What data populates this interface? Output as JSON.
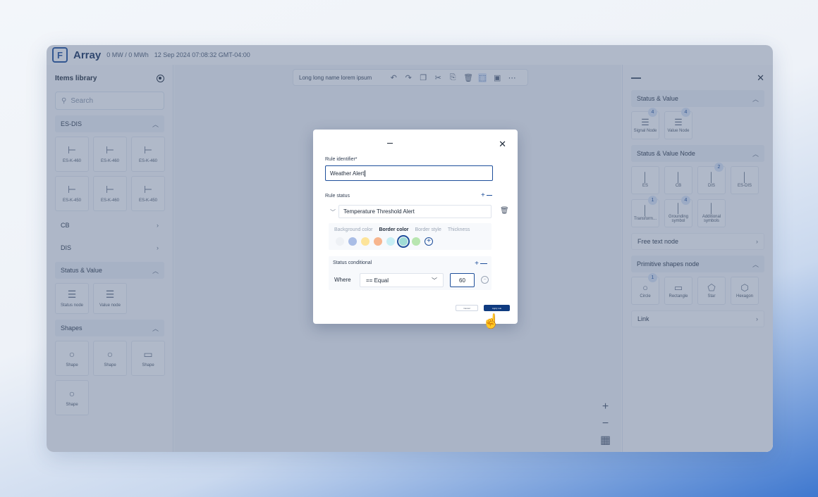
{
  "app": {
    "brand": "Array",
    "power": "0 MW / 0 MWh",
    "timestamp": "12 Sep 2024 07:08:32 GMT-04:00"
  },
  "left_panel": {
    "title": "Items library",
    "search_placeholder": "Search",
    "sections": {
      "es_dis": "ES-DIS",
      "cb": "CB",
      "dis": "DIS",
      "status_value": "Status & Value",
      "shapes": "Shapes"
    },
    "es_items": [
      "ES-K-460",
      "ES-K-460",
      "ES-K-460",
      "ES-K-450",
      "ES-K-460",
      "ES-K-450"
    ],
    "status_items": [
      "Status node",
      "Value node"
    ],
    "shape_items": [
      "Shape",
      "Shape",
      "Shape",
      "Shape"
    ]
  },
  "toolbar": {
    "name": "Long long name lorem ipsum"
  },
  "right_panel": {
    "sec_status_value": "Status & Value",
    "status_value_items": [
      {
        "label": "Signal Node",
        "badge": "4"
      },
      {
        "label": "Value Node",
        "badge": "4"
      }
    ],
    "sec_status_value_node": "Status & Value Node",
    "node_items": [
      {
        "label": "ES",
        "badge": ""
      },
      {
        "label": "CB",
        "badge": ""
      },
      {
        "label": "DIS",
        "badge": "2"
      },
      {
        "label": "ES-DIS",
        "badge": ""
      },
      {
        "label": "Transform...",
        "badge": "1"
      },
      {
        "label": "Grounding symbol",
        "badge": "4"
      },
      {
        "label": "Additional symbols",
        "badge": ""
      }
    ],
    "sec_free_text": "Free text node",
    "sec_primitive": "Primitive shapes node",
    "shape_items": [
      {
        "label": "Circle",
        "badge": "1"
      },
      {
        "label": "Rectangle",
        "badge": ""
      },
      {
        "label": "Star",
        "badge": ""
      },
      {
        "label": "Hexagon",
        "badge": ""
      }
    ],
    "sec_link": "Link"
  },
  "modal": {
    "identifier_label": "Rule identifier*",
    "identifier_value": "Weather Alert",
    "status_label": "Rule status",
    "status_value": "Temperature Threshold Alert",
    "style_tabs": [
      "Background color",
      "Border color",
      "Border style",
      "Thickness"
    ],
    "active_tab": "Border color",
    "swatches": [
      "#eef1f5",
      "#a9bde6",
      "#fde49a",
      "#f7b58e",
      "#c7eef4",
      "#9fdcd6",
      "#b8e6b0"
    ],
    "selected_swatch_index": 5,
    "conditional_label": "Status conditional",
    "where_label": "Where",
    "operator": "== Equal",
    "compare_value": "60",
    "cancel_label": "Cancel",
    "apply_label": "Apply rule"
  }
}
